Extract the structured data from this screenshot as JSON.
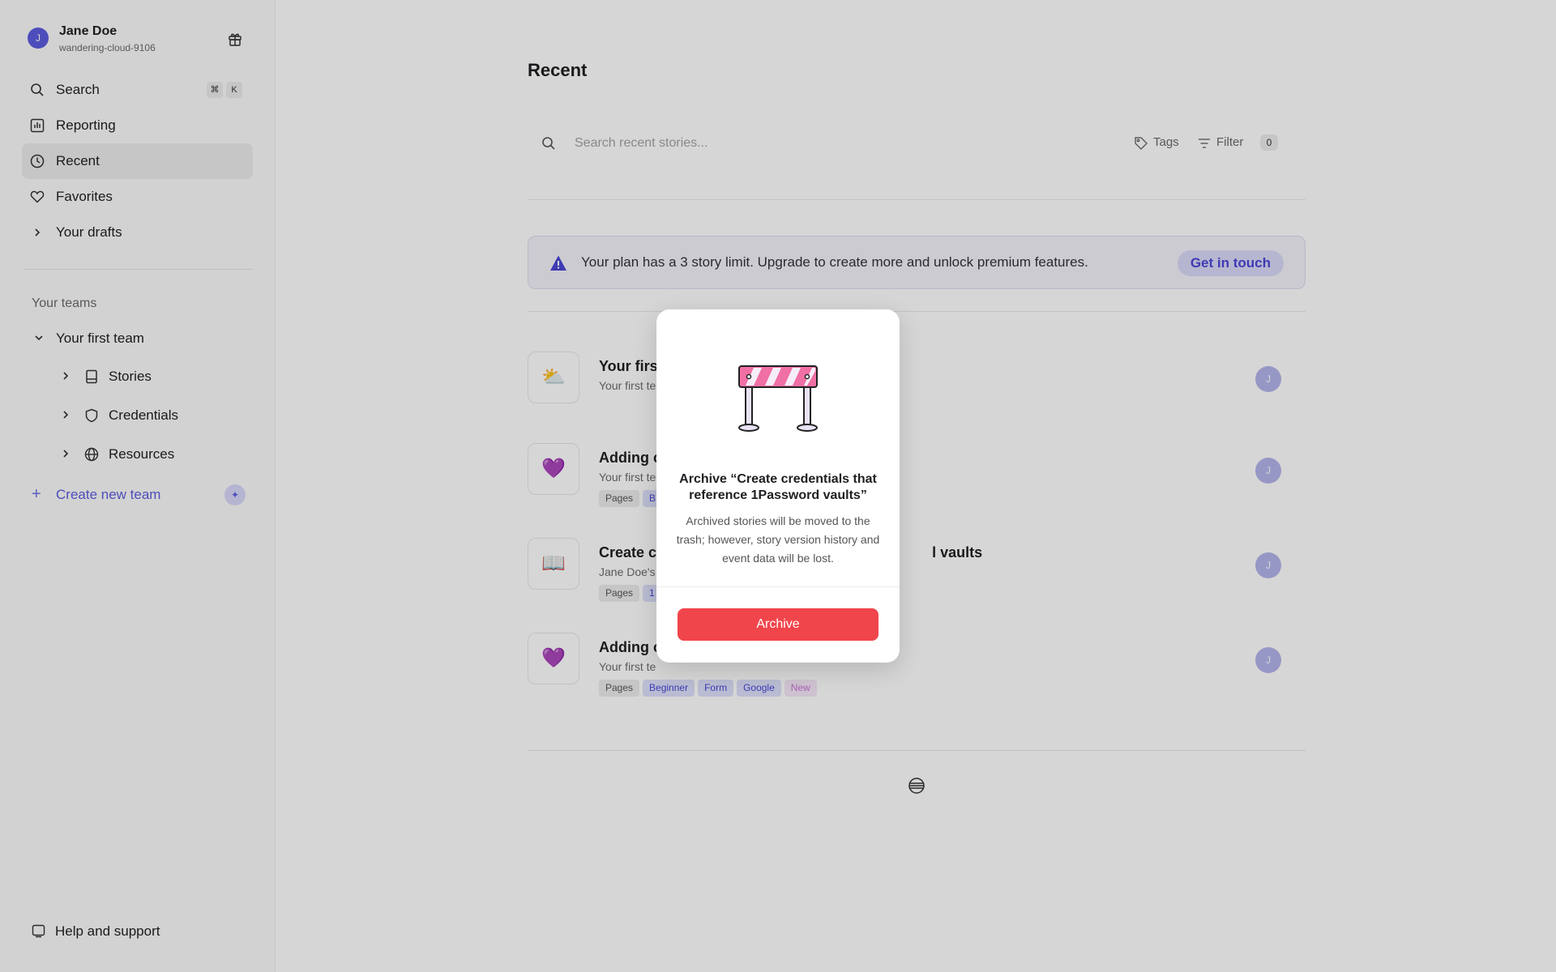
{
  "profile": {
    "name": "Jane Doe",
    "subtitle": "wandering-cloud-9106",
    "avatar_letter": "J"
  },
  "nav": {
    "search": "Search",
    "search_shortcut": [
      "⌘",
      "K"
    ],
    "reporting": "Reporting",
    "recent": "Recent",
    "favorites": "Favorites",
    "drafts": "Your drafts"
  },
  "teams": {
    "section_title": "Your teams",
    "team_name": "Your first team",
    "children": [
      "Stories",
      "Credentials",
      "Resources"
    ],
    "create": "Create new team"
  },
  "help": "Help and support",
  "main": {
    "title": "Recent",
    "search_placeholder": "Search recent stories...",
    "tags_label": "Tags",
    "filter_label": "Filter",
    "filter_count": "0",
    "banner_text": "Your plan has a 3 story limit. Upgrade to create more and unlock premium features.",
    "banner_cta": "Get in touch"
  },
  "stories": [
    {
      "title": "Your firs",
      "subtitle": "Your first te",
      "thumb": "⛅",
      "avatar": "J",
      "tags": []
    },
    {
      "title": "Adding c",
      "subtitle": "Your first te",
      "thumb": "💜",
      "avatar": "J",
      "tags": [
        "Pages",
        "B"
      ]
    },
    {
      "title": "Create c                                                                    l vaults",
      "subtitle": "Jane Doe's",
      "thumb": "📖",
      "avatar": "J",
      "tags": [
        "Pages",
        "1"
      ]
    },
    {
      "title": "Adding c",
      "subtitle": "Your first te",
      "thumb": "💜",
      "avatar": "J",
      "tags": [
        "Pages",
        "Beginner",
        "Form",
        "Google",
        "New"
      ]
    }
  ],
  "modal": {
    "title": "Archive “Create credentials that reference 1Password vaults”",
    "body": "Archived stories will be moved to the trash; however, story version history and event data will be lost.",
    "button": "Archive"
  },
  "colors": {
    "accent": "#5c5ce0",
    "danger": "#f0454b",
    "overlay": "rgba(0,0,0,0.16)"
  }
}
